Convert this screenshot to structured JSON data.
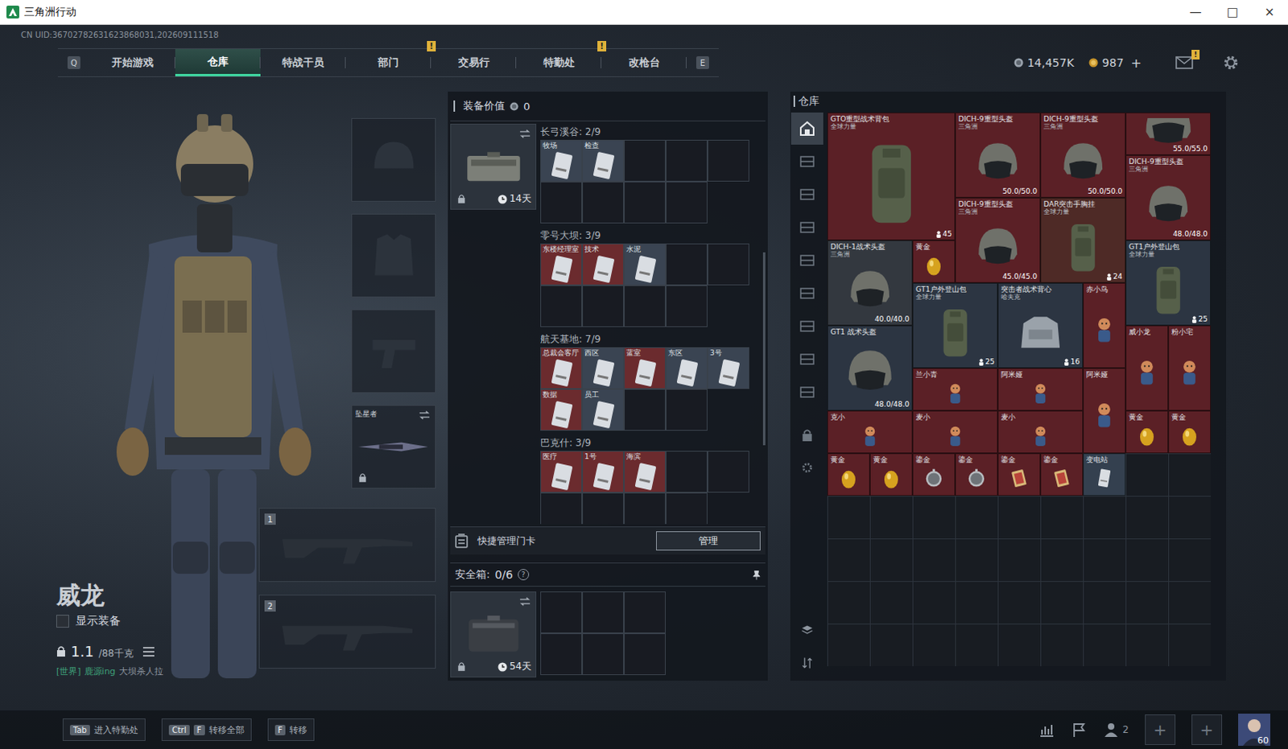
{
  "window": {
    "title": "三角洲行动",
    "controls": [
      "—",
      "□",
      "×"
    ]
  },
  "uid": "CN UID:36702782631623868031,202609111518",
  "nav": {
    "prev_key": "Q",
    "next_key": "E",
    "alert_mark": "!",
    "tabs": [
      {
        "label": "开始游戏",
        "selected": false,
        "alert": false
      },
      {
        "label": "仓库",
        "selected": true,
        "alert": false
      },
      {
        "label": "特战干员",
        "selected": false,
        "alert": false
      },
      {
        "label": "部门",
        "selected": false,
        "alert": true
      },
      {
        "label": "交易行",
        "selected": false,
        "alert": false
      },
      {
        "label": "特勤处",
        "selected": false,
        "alert": true
      },
      {
        "label": "改枪台",
        "selected": false,
        "alert": false
      }
    ]
  },
  "resources": {
    "coins": "14,457K",
    "points": "987",
    "add": "+",
    "mail_badge": "!"
  },
  "operator": {
    "name": "威龙",
    "show_gear": {
      "label": "显示装备",
      "checked": false
    },
    "weight": "1.1",
    "weight_max": "/88千克",
    "chat": {
      "channel": "[世界]",
      "user": "鹿源ing",
      "message": "大坝杀人拉"
    }
  },
  "gear_slots": [
    {
      "kind": "helmet",
      "name": "",
      "locked": false,
      "swap": false
    },
    {
      "kind": "armor",
      "name": "",
      "locked": false,
      "swap": false
    },
    {
      "kind": "pistol",
      "name": "",
      "locked": false,
      "swap": false
    },
    {
      "kind": "melee",
      "name": "坠星者",
      "locked": true,
      "swap": true
    }
  ],
  "weapon_slots": [
    {
      "number": "1"
    },
    {
      "number": "2"
    }
  ],
  "equipment_value": {
    "label": "装备价值",
    "value": "0"
  },
  "key_case": {
    "days": "14天",
    "locked": true,
    "sections": [
      {
        "title": "长弓溪谷: 2/9",
        "slots": 9,
        "cards": [
          {
            "name": "牧场",
            "color": "#3a4452"
          },
          {
            "name": "检查",
            "color": "#3a4452"
          }
        ]
      },
      {
        "title": "零号大坝: 3/9",
        "slots": 9,
        "cards": [
          {
            "name": "东楼经理室",
            "color": "#6b2b2e"
          },
          {
            "name": "技术",
            "color": "#6b2b2e"
          },
          {
            "name": "水泥",
            "color": "#3a4452"
          }
        ]
      },
      {
        "title": "航天基地: 7/9",
        "slots": 9,
        "cards": [
          {
            "name": "总裁会客厅",
            "color": "#6b2b2e"
          },
          {
            "name": "西区",
            "color": "#3a4452"
          },
          {
            "name": "蓝室",
            "color": "#6b2b2e"
          },
          {
            "name": "东区",
            "color": "#3a4452"
          },
          {
            "name": "3号",
            "color": "#3a4452"
          },
          {
            "name": "数据",
            "color": "#6b2b2e"
          },
          {
            "name": "员工",
            "color": "#3a4452"
          }
        ]
      },
      {
        "title": "巴克什: 3/9",
        "slots": 9,
        "cards": [
          {
            "name": "医疗",
            "color": "#6b2b2e"
          },
          {
            "name": "1号",
            "color": "#6b2b2e"
          },
          {
            "name": "海滨",
            "color": "#6b2b2e"
          }
        ]
      }
    ]
  },
  "quick_cards": {
    "label": "快捷管理门卡",
    "button": "管理"
  },
  "safe_box": {
    "label": "安全箱:",
    "count": "0/6",
    "help": "?",
    "days": "54天",
    "locked": true,
    "slots": 6
  },
  "stash": {
    "title": "仓库",
    "tabs": [
      {
        "selected": true
      },
      {
        "selected": false
      },
      {
        "selected": false
      },
      {
        "selected": false
      },
      {
        "selected": false
      },
      {
        "selected": false
      },
      {
        "selected": false
      },
      {
        "selected": false
      },
      {
        "selected": false
      }
    ],
    "items": [
      {
        "name": "GTO重型战术背包",
        "sub": "全球力量",
        "kind": "pack-large",
        "color": "#5b2026",
        "durability": "",
        "count": "45"
      },
      {
        "name": "DICH-9重型头盔",
        "sub": "三角洲",
        "kind": "helmet",
        "color": "#5b2026",
        "durability": "50.0/50.0",
        "count": ""
      },
      {
        "name": "DICH-9重型头盔",
        "sub": "三角洲",
        "kind": "helmet",
        "color": "#5b2026",
        "durability": "50.0/50.0",
        "count": ""
      },
      {
        "name": "",
        "sub": "",
        "kind": "helmet-cut",
        "color": "#5b2026",
        "durability": "55.0/55.0",
        "count": ""
      },
      {
        "name": "DICH-9重型头盔",
        "sub": "三角洲",
        "kind": "helmet",
        "color": "#5b2026",
        "durability": "48.0/48.0",
        "count": ""
      },
      {
        "name": "DICH-9重型头盔",
        "sub": "三角洲",
        "kind": "helmet",
        "color": "#5b2026",
        "durability": "45.0/45.0",
        "count": ""
      },
      {
        "name": "DAR突击手胸挂",
        "sub": "全球力量",
        "kind": "pack",
        "color": "#4e2a26",
        "durability": "",
        "count": "24"
      },
      {
        "name": "DICH-1战术头盔",
        "sub": "三角洲",
        "kind": "helmet",
        "color": "#33383f",
        "durability": "40.0/40.0",
        "count": ""
      },
      {
        "name": "黄金",
        "sub": "",
        "kind": "egg",
        "color": "#5b2026",
        "durability": "",
        "count": ""
      },
      {
        "name": "GT1户外登山包",
        "sub": "全球力量",
        "kind": "pack",
        "color": "#2c3542",
        "durability": "",
        "count": "25"
      },
      {
        "name": "GT1户外登山包",
        "sub": "全球力量",
        "kind": "pack",
        "color": "#2c3542",
        "durability": "",
        "count": "25"
      },
      {
        "name": "突击者战术背心",
        "sub": "哈夫克",
        "kind": "vest",
        "color": "#2c3542",
        "durability": "",
        "count": "16"
      },
      {
        "name": "赤小鸟",
        "sub": "",
        "kind": "figure-tall",
        "color": "#5b2026",
        "durability": "",
        "count": ""
      },
      {
        "name": "GT1 战术头盔",
        "sub": "",
        "kind": "helmet",
        "color": "#2c3542",
        "durability": "48.0/48.0",
        "count": ""
      },
      {
        "name": "威小龙",
        "sub": "",
        "kind": "figure-tall",
        "color": "#5b2026",
        "durability": "",
        "count": ""
      },
      {
        "name": "粉小宅",
        "sub": "",
        "kind": "figure-tall",
        "color": "#5b2026",
        "durability": "",
        "count": ""
      },
      {
        "name": "兰小青",
        "sub": "",
        "kind": "figure-wide",
        "color": "#5b2026",
        "durability": "",
        "count": ""
      },
      {
        "name": "阿米娅",
        "sub": "",
        "kind": "figure-wide",
        "color": "#5b2026",
        "durability": "",
        "count": ""
      },
      {
        "name": "阿米娅",
        "sub": "",
        "kind": "figure-tall",
        "color": "#5b2026",
        "durability": "",
        "count": ""
      },
      {
        "name": "克小",
        "sub": "",
        "kind": "figure-wide",
        "color": "#5b2026",
        "durability": "",
        "count": ""
      },
      {
        "name": "麦小",
        "sub": "",
        "kind": "figure-wide",
        "color": "#5b2026",
        "durability": "",
        "count": ""
      },
      {
        "name": "麦小",
        "sub": "",
        "kind": "figure-wide",
        "color": "#5b2026",
        "durability": "",
        "count": ""
      },
      {
        "name": "黄金",
        "sub": "",
        "kind": "egg",
        "color": "#5b2026",
        "durability": "",
        "count": ""
      },
      {
        "name": "黄金",
        "sub": "",
        "kind": "egg",
        "color": "#5b2026",
        "durability": "",
        "count": ""
      },
      {
        "name": "黄金",
        "sub": "",
        "kind": "egg",
        "color": "#5b2026",
        "durability": "",
        "count": ""
      },
      {
        "name": "黄金",
        "sub": "",
        "kind": "egg",
        "color": "#5b2026",
        "durability": "",
        "count": ""
      },
      {
        "name": "鎏金",
        "sub": "",
        "kind": "watch",
        "color": "#5b2026",
        "durability": "",
        "count": ""
      },
      {
        "name": "鎏金",
        "sub": "",
        "kind": "watch",
        "color": "#5b2026",
        "durability": "",
        "count": ""
      },
      {
        "name": "鎏金",
        "sub": "",
        "kind": "card",
        "color": "#5b2026",
        "durability": "",
        "count": ""
      },
      {
        "name": "鎏金",
        "sub": "",
        "kind": "card",
        "color": "#5b2026",
        "durability": "",
        "count": ""
      },
      {
        "name": "变电站",
        "sub": "",
        "kind": "keycard",
        "color": "#34404f",
        "durability": "",
        "count": ""
      }
    ]
  },
  "hints": [
    {
      "keys": [
        "Tab"
      ],
      "label": "进入特勤处"
    },
    {
      "keys": [
        "Ctrl",
        "F"
      ],
      "label": "转移全部"
    },
    {
      "keys": [
        "F"
      ],
      "label": "转移"
    }
  ],
  "social": {
    "friends": "2",
    "invites": [
      "+",
      "+"
    ],
    "level": "60"
  }
}
